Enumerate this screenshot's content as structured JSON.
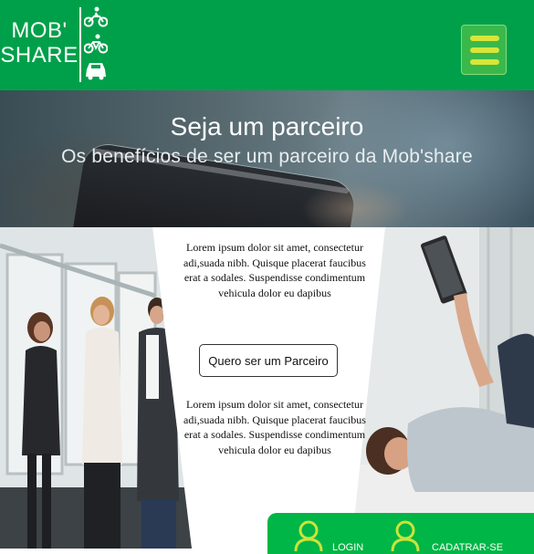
{
  "header": {
    "logo_line1": "MOB'",
    "logo_line2": "SHARE",
    "logo_icons": [
      "motorcycle-icon",
      "bicycle-icon",
      "car-icon"
    ],
    "menu_icon": "hamburger-menu-icon"
  },
  "hero": {
    "title": "Seja um parceiro",
    "subtitle": "Os benefícios de ser um parceiro da Mob'share"
  },
  "content": {
    "paragraph1": "Lorem ipsum dolor sit amet, consectetur adi,suada nibh. Quisque placerat faucibus erat a sodales. Suspendisse condimentum vehicula dolor eu dapibus",
    "cta_label": "Quero ser um Parceiro",
    "paragraph2": "Lorem ipsum dolor sit amet, consectetur adi,suada nibh. Quisque placerat faucibus erat a sodales. Suspendisse condimentum vehicula dolor eu dapibus"
  },
  "login_bar": {
    "login_label": "LOGIN",
    "signup_label": "CADATRAR-SE",
    "user_icon": "user-icon"
  },
  "colors": {
    "brand_green": "#00a04a",
    "menu_bars": "#d7e63a",
    "login_bar": "#00b646",
    "login_icon": "#c9e43a"
  }
}
